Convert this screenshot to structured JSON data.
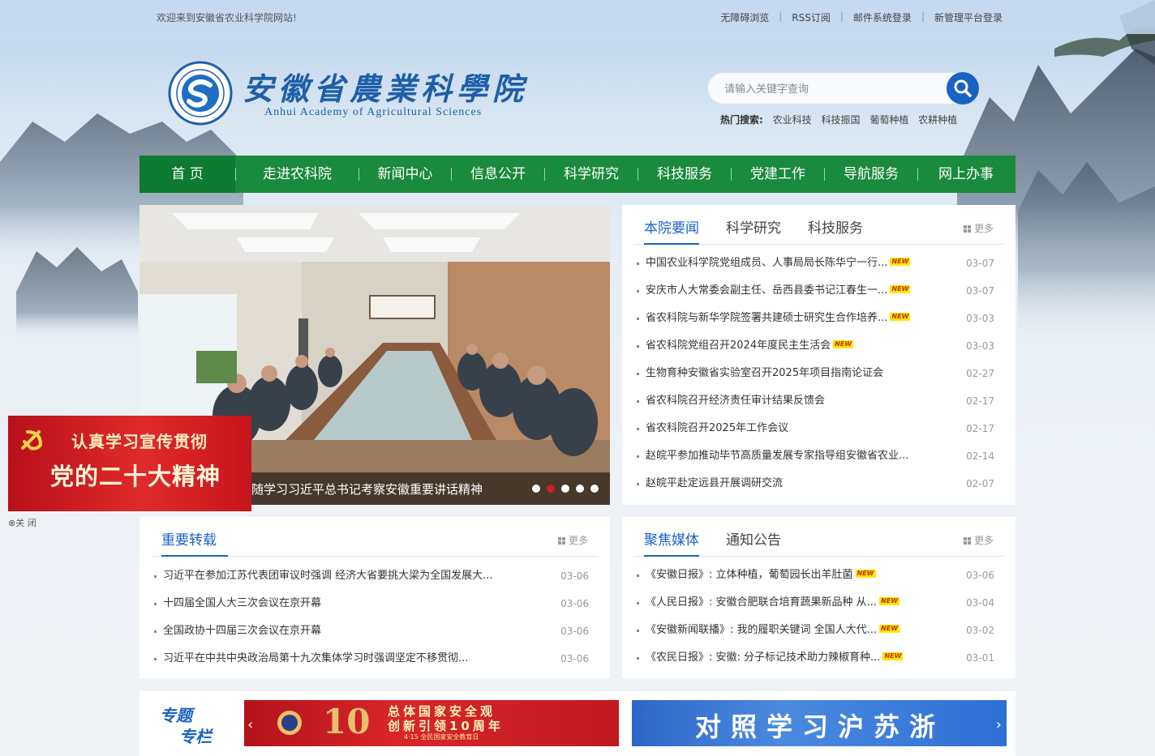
{
  "topbar": {
    "welcome": "欢迎来到安徽省农业科学院网站!",
    "links": [
      "无障碍浏览",
      "RSS订阅",
      "邮件系统登录",
      "新管理平台登录"
    ],
    "separator": "|"
  },
  "logo": {
    "name_cn": "安徽省農業科學院",
    "name_en": "Anhui Academy of Agricultural Sciences"
  },
  "search": {
    "placeholder": "请输入关键字查询",
    "hot_label": "热门搜索:",
    "hot_words": [
      "农业科技",
      "科技振国",
      "葡萄种植",
      "农耕种植"
    ]
  },
  "nav": [
    "首 页",
    "走进农科院",
    "新闻中心",
    "信息公开",
    "科学研究",
    "科技服务",
    "党建工作",
    "导航服务",
    "网上办事"
  ],
  "banner": {
    "caption": "随学习习近平总书记考察安徽重要讲话精神",
    "active_dot": 1,
    "dot_count": 5
  },
  "news": {
    "tabs": [
      "本院要闻",
      "科学研究",
      "科技服务"
    ],
    "more": "更多",
    "items": [
      {
        "title": "中国农业科学院党组成员、人事局局长陈华宁一行...",
        "date": "03-07",
        "is_new": true
      },
      {
        "title": "安庆市人大常委会副主任、岳西县委书记江春生一...",
        "date": "03-07",
        "is_new": true
      },
      {
        "title": "省农科院与新华学院签署共建硕士研究生合作培养...",
        "date": "03-03",
        "is_new": true
      },
      {
        "title": "省农科院党组召开2024年度民主生活会",
        "date": "03-03",
        "is_new": true
      },
      {
        "title": "生物育种安徽省实验室召开2025年项目指南论证会",
        "date": "02-27",
        "is_new": false
      },
      {
        "title": "省农科院召开经济责任审计结果反馈会",
        "date": "02-17",
        "is_new": false
      },
      {
        "title": "省农科院召开2025年工作会议",
        "date": "02-17",
        "is_new": false
      },
      {
        "title": "赵皖平参加推动毕节高质量发展专家指导组安徽省农业...",
        "date": "02-14",
        "is_new": false
      },
      {
        "title": "赵皖平赴定远县开展调研交流",
        "date": "02-07",
        "is_new": false
      }
    ]
  },
  "reprint": {
    "tabs": [
      "重要转载"
    ],
    "more": "更多",
    "items": [
      {
        "title": "习近平在参加江苏代表团审议时强调 经济大省要挑大梁为全国发展大...",
        "date": "03-06"
      },
      {
        "title": "十四届全国人大三次会议在京开幕",
        "date": "03-06"
      },
      {
        "title": "全国政协十四届三次会议在京开幕",
        "date": "03-06"
      },
      {
        "title": "习近平在中共中央政治局第十九次集体学习时强调坚定不移贯彻...",
        "date": "03-06"
      }
    ]
  },
  "media": {
    "tabs": [
      "聚焦媒体",
      "通知公告"
    ],
    "more": "更多",
    "items": [
      {
        "title": "《安徽日报》: 立体种植，葡萄园长出羊肚菌",
        "date": "03-06",
        "is_new": true
      },
      {
        "title": "《人民日报》: 安徽合肥联合培育蔬果新品种 从...",
        "date": "03-04",
        "is_new": true
      },
      {
        "title": "《安徽新闻联播》: 我的履职关键词 全国人大代...",
        "date": "03-02",
        "is_new": true
      },
      {
        "title": "《农民日报》: 安徽: 分子标记技术助力辣椒育种...",
        "date": "03-01",
        "is_new": true
      }
    ]
  },
  "new_badge": "NEW",
  "special": {
    "label_1": "专题",
    "label_2": "专栏",
    "banner_a": {
      "line1": "总体国家安全观",
      "line2": "创新引领10周年",
      "line3": "4·15 全民国家安全教育日",
      "number": "10"
    },
    "banner_b": {
      "text": "对照学习沪苏浙"
    },
    "prev": "‹",
    "next": "›"
  },
  "float_ad": {
    "line1": "认真学习宣传贯彻",
    "line2": "党的二十大精神",
    "close": "⊗关 闭"
  },
  "colors": {
    "nav_green": "#1a8a3c",
    "accent_blue": "#1a62c4",
    "float_red": "#d02020"
  }
}
